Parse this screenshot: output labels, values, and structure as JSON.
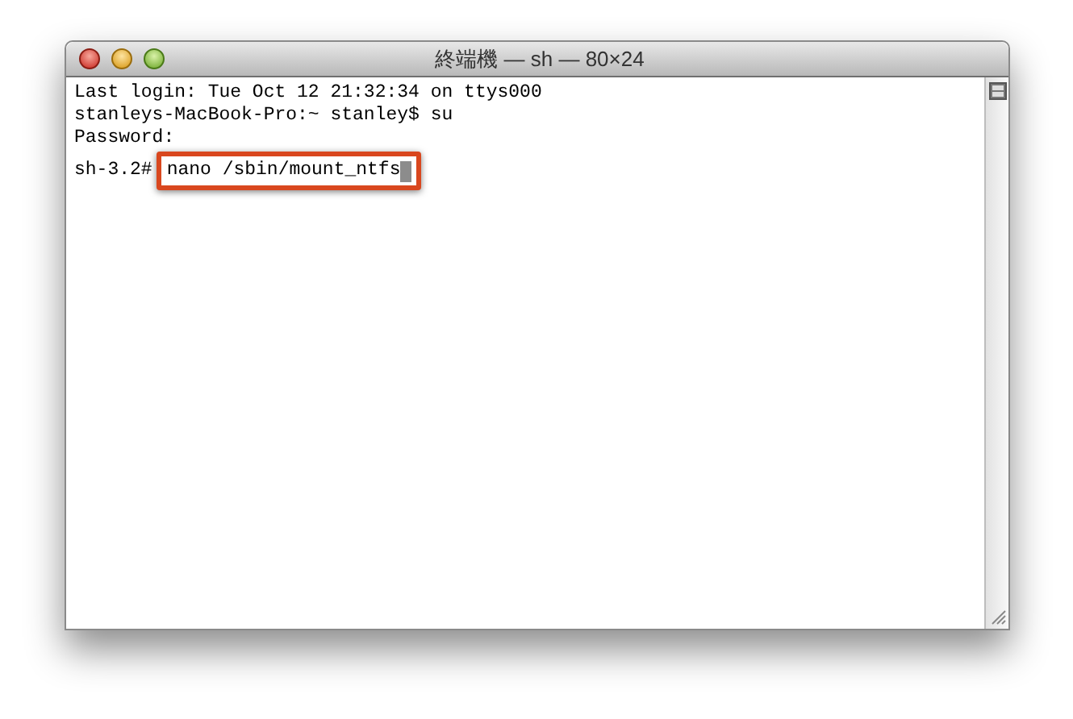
{
  "window": {
    "title": "終端機 — sh — 80×24"
  },
  "terminal": {
    "lines": [
      {
        "text": "Last login: Tue Oct 12 21:32:34 on ttys000"
      },
      {
        "text": "stanleys-MacBook-Pro:~ stanley$ su"
      },
      {
        "text": "Password:"
      },
      {
        "prompt": "sh-3.2#",
        "command": "nano /sbin/mount_ntfs",
        "highlighted": true,
        "cursor": true
      }
    ]
  }
}
